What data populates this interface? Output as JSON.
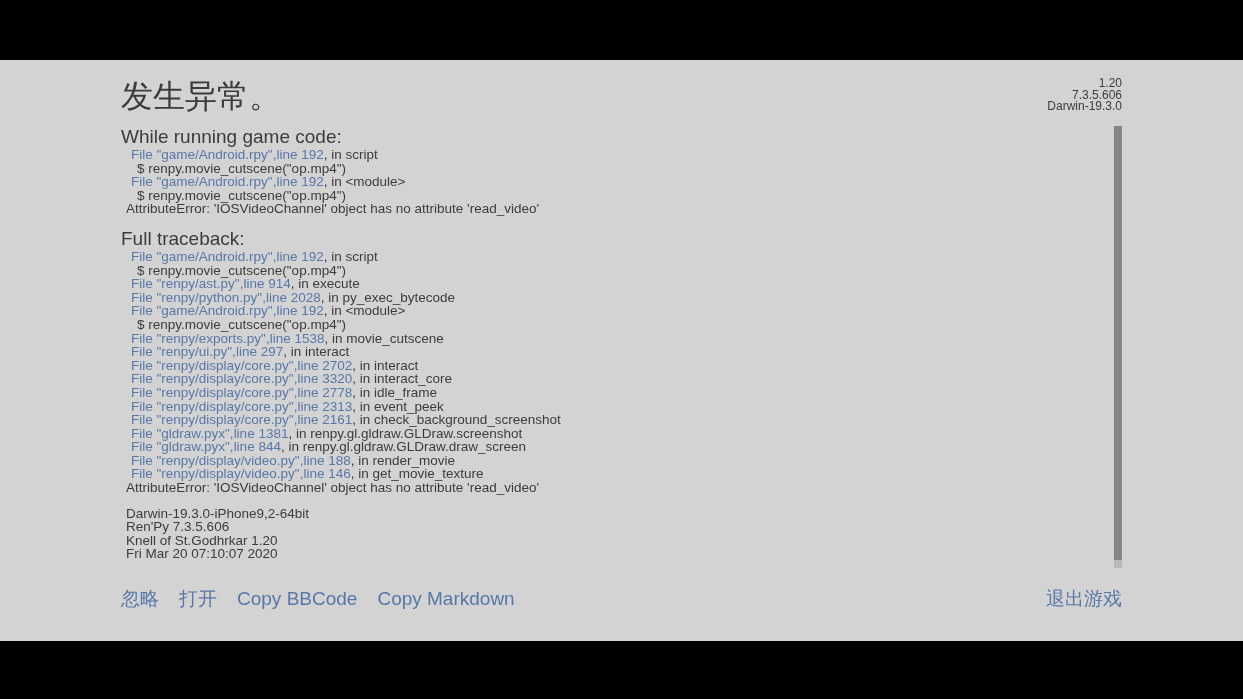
{
  "title": "发生异常。",
  "version_info": [
    "1.20",
    "7.3.5.606",
    "Darwin-19.3.0"
  ],
  "sections": [
    {
      "heading": "While running game code:",
      "lines": [
        {
          "kind": "frame",
          "file": "File \"game/Android.rpy\",",
          "line": "line 192",
          "rest": ", in script"
        },
        {
          "kind": "code",
          "text": "$ renpy.movie_cutscene(\"op.mp4\")"
        },
        {
          "kind": "frame",
          "file": "File \"game/Android.rpy\",",
          "line": "line 192",
          "rest": ", in <module>"
        },
        {
          "kind": "code",
          "text": "$ renpy.movie_cutscene(\"op.mp4\")"
        },
        {
          "kind": "error",
          "text": "AttributeError: 'IOSVideoChannel' object has no attribute 'read_video'"
        }
      ]
    },
    {
      "heading": "Full traceback:",
      "lines": [
        {
          "kind": "frame",
          "file": "File \"game/Android.rpy\",",
          "line": "line 192",
          "rest": ", in script"
        },
        {
          "kind": "code",
          "text": "$ renpy.movie_cutscene(\"op.mp4\")"
        },
        {
          "kind": "frame",
          "file": "File \"renpy/ast.py\",",
          "line": "line 914",
          "rest": ", in execute"
        },
        {
          "kind": "frame",
          "file": "File \"renpy/python.py\",",
          "line": "line 2028",
          "rest": ", in py_exec_bytecode"
        },
        {
          "kind": "frame",
          "file": "File \"game/Android.rpy\",",
          "line": "line 192",
          "rest": ", in <module>"
        },
        {
          "kind": "code",
          "text": "$ renpy.movie_cutscene(\"op.mp4\")"
        },
        {
          "kind": "frame",
          "file": "File \"renpy/exports.py\",",
          "line": "line 1538",
          "rest": ", in movie_cutscene"
        },
        {
          "kind": "frame",
          "file": "File \"renpy/ui.py\",",
          "line": "line 297",
          "rest": ", in interact"
        },
        {
          "kind": "frame",
          "file": "File \"renpy/display/core.py\",",
          "line": "line 2702",
          "rest": ", in interact"
        },
        {
          "kind": "frame",
          "file": "File \"renpy/display/core.py\",",
          "line": "line 3320",
          "rest": ", in interact_core"
        },
        {
          "kind": "frame",
          "file": "File \"renpy/display/core.py\",",
          "line": "line 2778",
          "rest": ", in idle_frame"
        },
        {
          "kind": "frame",
          "file": "File \"renpy/display/core.py\",",
          "line": "line 2313",
          "rest": ", in event_peek"
        },
        {
          "kind": "frame",
          "file": "File \"renpy/display/core.py\",",
          "line": "line 2161",
          "rest": ", in check_background_screenshot"
        },
        {
          "kind": "frame",
          "file": "File \"gldraw.pyx\",",
          "line": "line 1381",
          "rest": ", in renpy.gl.gldraw.GLDraw.screenshot"
        },
        {
          "kind": "frame",
          "file": "File \"gldraw.pyx\",",
          "line": "line 844",
          "rest": ", in renpy.gl.gldraw.GLDraw.draw_screen"
        },
        {
          "kind": "frame",
          "file": "File \"renpy/display/video.py\",",
          "line": "line 188",
          "rest": ", in render_movie"
        },
        {
          "kind": "frame",
          "file": "File \"renpy/display/video.py\",",
          "line": "line 146",
          "rest": ", in get_movie_texture"
        },
        {
          "kind": "error",
          "text": "AttributeError: 'IOSVideoChannel' object has no attribute 'read_video'"
        }
      ]
    }
  ],
  "system_info": [
    "Darwin-19.3.0-iPhone9,2-64bit",
    "Ren'Py 7.3.5.606",
    "Knell of St.Godhrkar 1.20",
    "Fri Mar 20 07:10:07 2020"
  ],
  "buttons": [
    "忽略",
    "打开",
    "Copy BBCode",
    "Copy Markdown"
  ],
  "quit_button": "退出游戏"
}
